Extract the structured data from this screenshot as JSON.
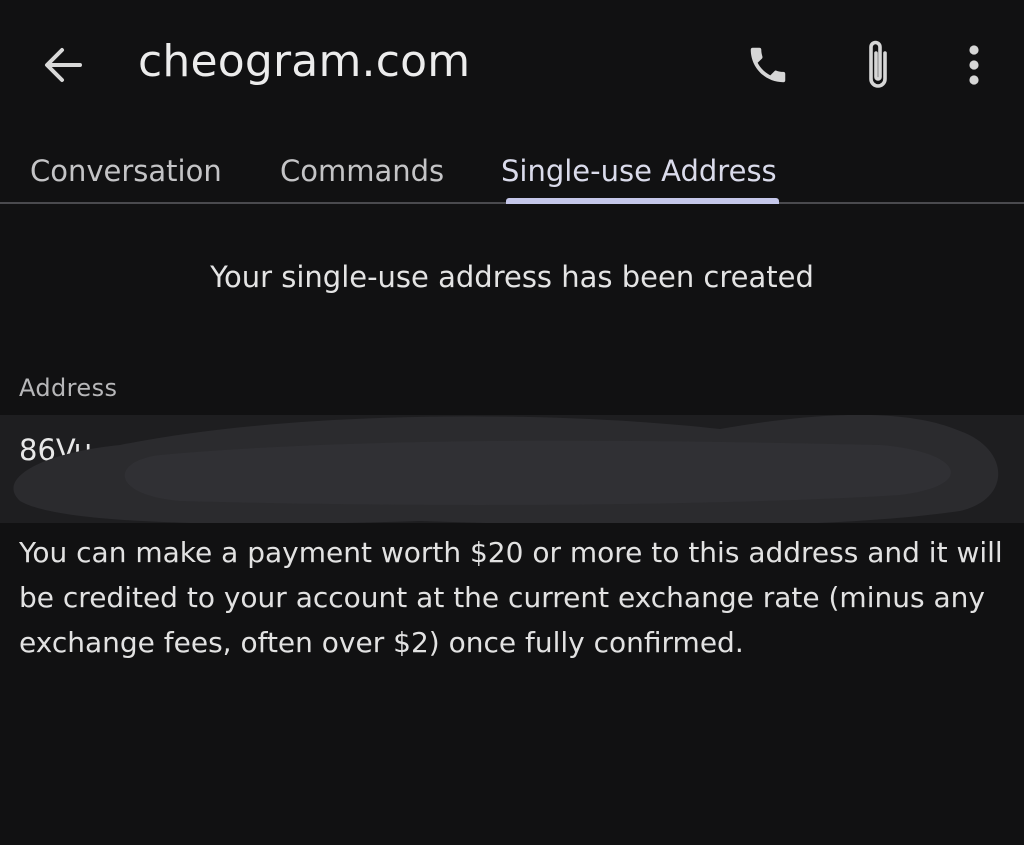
{
  "appbar": {
    "title": "cheogram.com",
    "icons": {
      "back": "arrow-left-icon",
      "call": "phone-icon",
      "attach": "paperclip-icon",
      "more": "more-vertical-icon"
    }
  },
  "tabs": [
    {
      "label": "Conversation",
      "selected": false
    },
    {
      "label": "Commands",
      "selected": false
    },
    {
      "label": "Single-use Address",
      "selected": true
    }
  ],
  "content": {
    "created_message": "Your single-use address has been created",
    "address_label": "Address",
    "address_value_visible": "86Vu",
    "payment_note": "You can make a payment worth $20 or more to this address and it will be credited to your account at the current exchange rate (minus any exchange fees, often over $2) once fully confirmed."
  },
  "colors": {
    "background": "#111112",
    "field_background": "#1e1e20",
    "tab_indicator": "#c5c7ea",
    "text": "#e6e6e6"
  }
}
